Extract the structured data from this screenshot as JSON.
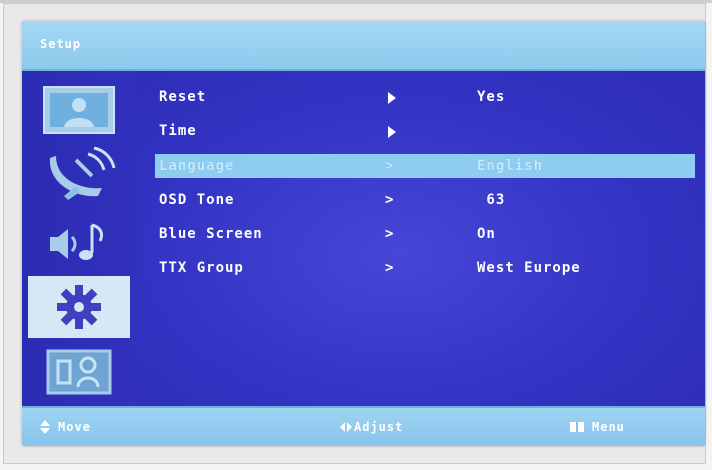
{
  "header": {
    "title": "Setup"
  },
  "sidebar": {
    "items": [
      {
        "icon": "picture-icon"
      },
      {
        "icon": "antenna-signal-icon"
      },
      {
        "icon": "speaker-note-icon"
      },
      {
        "icon": "gear-icon",
        "active": true
      },
      {
        "icon": "person-frame-icon"
      }
    ]
  },
  "menu": {
    "items": [
      {
        "label": "Reset",
        "arrow": "▶",
        "value": "Yes"
      },
      {
        "label": "Time",
        "arrow": "▶",
        "value": ""
      },
      {
        "label": "Language",
        "arrow": ">",
        "value": "English",
        "selected": true
      },
      {
        "label": "OSD Tone",
        "arrow": ">",
        "value": " 63"
      },
      {
        "label": "Blue Screen",
        "arrow": ">",
        "value": "On"
      },
      {
        "label": "TTX Group",
        "arrow": ">",
        "value": "West Europe"
      }
    ]
  },
  "footer": {
    "move_label": "Move",
    "adjust_label": "Adjust",
    "menu_label": "Menu"
  },
  "colors": {
    "background": "#3434c4",
    "bar": "#9fd4f2",
    "highlight": "#8fcdf0"
  }
}
